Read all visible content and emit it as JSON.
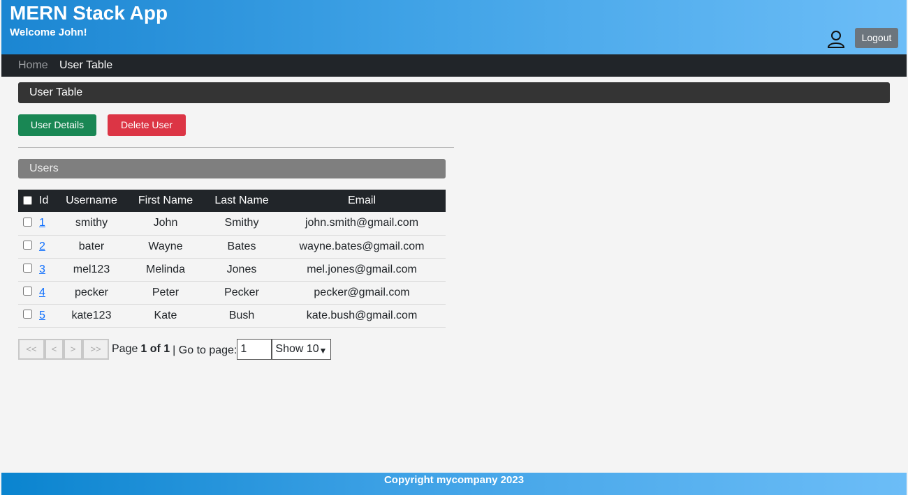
{
  "header": {
    "title": "MERN Stack App",
    "welcome": "Welcome John!",
    "user_icon": "user-icon",
    "logout_label": "Logout"
  },
  "nav": {
    "items": [
      {
        "label": "Home",
        "active": false
      },
      {
        "label": "User Table",
        "active": true
      }
    ]
  },
  "section_title": "User Table",
  "actions": {
    "details_label": "User Details",
    "delete_label": "Delete User"
  },
  "users_panel_title": "Users",
  "table": {
    "columns": [
      "Id",
      "Username",
      "First Name",
      "Last Name",
      "Email"
    ],
    "rows": [
      {
        "id": "1",
        "username": "smithy",
        "first": "John",
        "last": "Smithy",
        "email": "john.smith@gmail.com"
      },
      {
        "id": "2",
        "username": "bater",
        "first": "Wayne",
        "last": "Bates",
        "email": "wayne.bates@gmail.com"
      },
      {
        "id": "3",
        "username": "mel123",
        "first": "Melinda",
        "last": "Jones",
        "email": "mel.jones@gmail.com"
      },
      {
        "id": "4",
        "username": "pecker",
        "first": "Peter",
        "last": "Pecker",
        "email": "pecker@gmail.com"
      },
      {
        "id": "5",
        "username": "kate123",
        "first": "Kate",
        "last": "Bush",
        "email": "kate.bush@gmail.com"
      }
    ]
  },
  "pagination": {
    "first_label": "<<",
    "prev_label": "<",
    "next_label": ">",
    "last_label": ">>",
    "page_prefix": "Page",
    "page_of": "1 of 1",
    "goto_label": "| Go to page:",
    "goto_value": "1",
    "show_value": "Show 10"
  },
  "footer": "Copyright mycompany 2023",
  "colors": {
    "header_gradient_start": "#1b86d2",
    "header_gradient_end": "#6cbdf7",
    "navbar": "#212529",
    "details_button": "#198754",
    "delete_button": "#dc3545",
    "logout_button": "#6c757d"
  }
}
